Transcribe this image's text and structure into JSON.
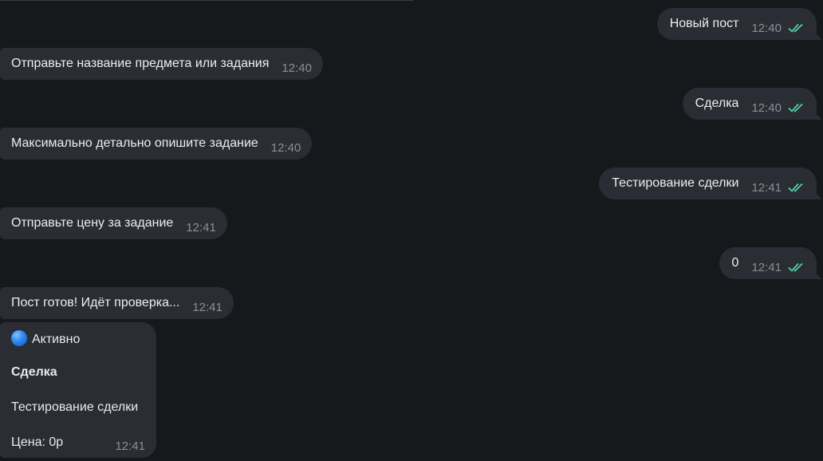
{
  "messages": [
    {
      "direction": "out",
      "text": "Новый пост",
      "time": "12:40",
      "read": true
    },
    {
      "direction": "in",
      "text": "Отправьте название предмета или задания",
      "time": "12:40"
    },
    {
      "direction": "out",
      "text": "Сделка",
      "time": "12:40",
      "read": true
    },
    {
      "direction": "in",
      "text": "Максимально детально опишите задание",
      "time": "12:40"
    },
    {
      "direction": "out",
      "text": "Тестирование сделки",
      "time": "12:41",
      "read": true
    },
    {
      "direction": "in",
      "text": "Отправьте цену за задание",
      "time": "12:41"
    },
    {
      "direction": "out",
      "text": "0",
      "time": "12:41",
      "read": true
    },
    {
      "direction": "in",
      "text": "Пост готов! Идёт проверка...",
      "time": "12:41"
    }
  ],
  "card": {
    "status_icon": "blue-circle-icon",
    "status": "Активно",
    "title": "Сделка",
    "description": "Тестирование сделки",
    "price": "Цена: 0р",
    "time": "12:41"
  },
  "colors": {
    "background": "#17181c",
    "bubble": "#2a2d33",
    "read_check": "#4fd1a5",
    "time_text": "#8b8f97"
  }
}
